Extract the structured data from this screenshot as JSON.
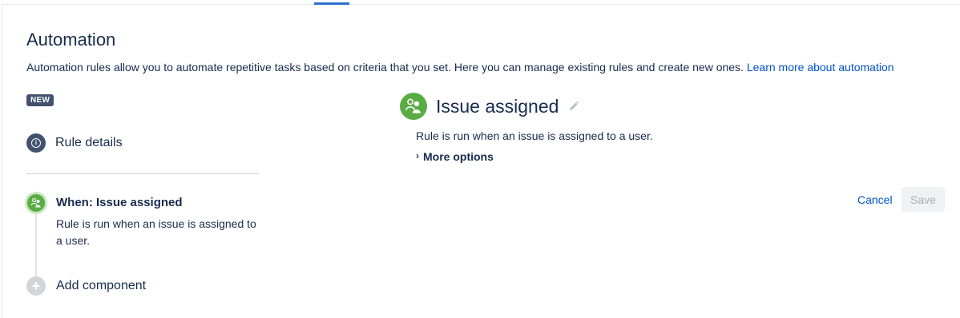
{
  "page": {
    "title": "Automation",
    "description": "Automation rules allow you to automate repetitive tasks based on criteria that you set. Here you can manage existing rules and create new ones.",
    "learn_more_link": "Learn more about automation"
  },
  "badge": {
    "label": "NEW"
  },
  "sidebar": {
    "rule_details": {
      "label": "Rule details",
      "icon": "info-icon"
    },
    "trigger": {
      "title": "When: Issue assigned",
      "description": "Rule is run when an issue is assigned to a user.",
      "icon": "user-assigned-icon",
      "color": "#5aac44"
    },
    "add_component": {
      "label": "Add component",
      "icon": "plus-icon"
    }
  },
  "detail": {
    "title": "Issue assigned",
    "description": "Rule is run when an issue is assigned to a user.",
    "more_options_label": "More options",
    "icon": "user-assigned-icon"
  },
  "actions": {
    "cancel_label": "Cancel",
    "save_label": "Save"
  },
  "colors": {
    "accent": "#0052cc",
    "trigger_green": "#5aac44",
    "badge_bg": "#42526e"
  }
}
